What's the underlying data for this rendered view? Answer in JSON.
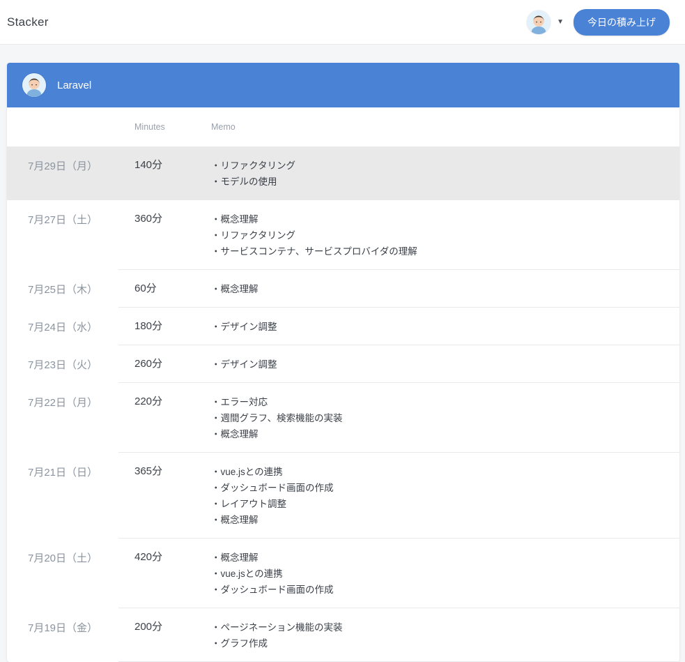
{
  "navbar": {
    "brand": "Stacker",
    "action_button": "今日の積み上げ"
  },
  "card": {
    "title": "Laravel",
    "table": {
      "columns": {
        "minutes": "Minutes",
        "memo": "Memo"
      },
      "rows": [
        {
          "date": "7月29日（月）",
          "minutes": "140分",
          "memo": [
            "・リファクタリング",
            "・モデルの使用"
          ],
          "highlight": true
        },
        {
          "date": "7月27日（土）",
          "minutes": "360分",
          "memo": [
            "・概念理解",
            "・リファクタリング",
            "・サービスコンテナ、サービスプロバイダの理解"
          ],
          "highlight": false
        },
        {
          "date": "7月25日（木）",
          "minutes": "60分",
          "memo": [
            "・概念理解"
          ],
          "highlight": false
        },
        {
          "date": "7月24日（水）",
          "minutes": "180分",
          "memo": [
            "・デザイン調整"
          ],
          "highlight": false
        },
        {
          "date": "7月23日（火）",
          "minutes": "260分",
          "memo": [
            "・デザイン調整"
          ],
          "highlight": false
        },
        {
          "date": "7月22日（月）",
          "minutes": "220分",
          "memo": [
            "・エラー対応",
            "・週間グラフ、検索機能の実装",
            "・概念理解"
          ],
          "highlight": false
        },
        {
          "date": "7月21日（日）",
          "minutes": "365分",
          "memo": [
            "・vue.jsとの連携",
            "・ダッシュボード画面の作成",
            "・レイアウト調整",
            "・概念理解"
          ],
          "highlight": false
        },
        {
          "date": "7月20日（土）",
          "minutes": "420分",
          "memo": [
            "・概念理解",
            "・vue.jsとの連携",
            "・ダッシュボード画面の作成"
          ],
          "highlight": false
        },
        {
          "date": "7月19日（金）",
          "minutes": "200分",
          "memo": [
            "・ページネーション機能の実装",
            "・グラフ作成"
          ],
          "highlight": false
        }
      ]
    }
  },
  "icons": {
    "user_avatar": "boy-avatar-icon",
    "dropdown": "chevron-down-icon"
  },
  "colors": {
    "accent_blue": "#4a82d6",
    "highlight_row": "#e9e9e9",
    "page_background": "#f4f6f8"
  }
}
